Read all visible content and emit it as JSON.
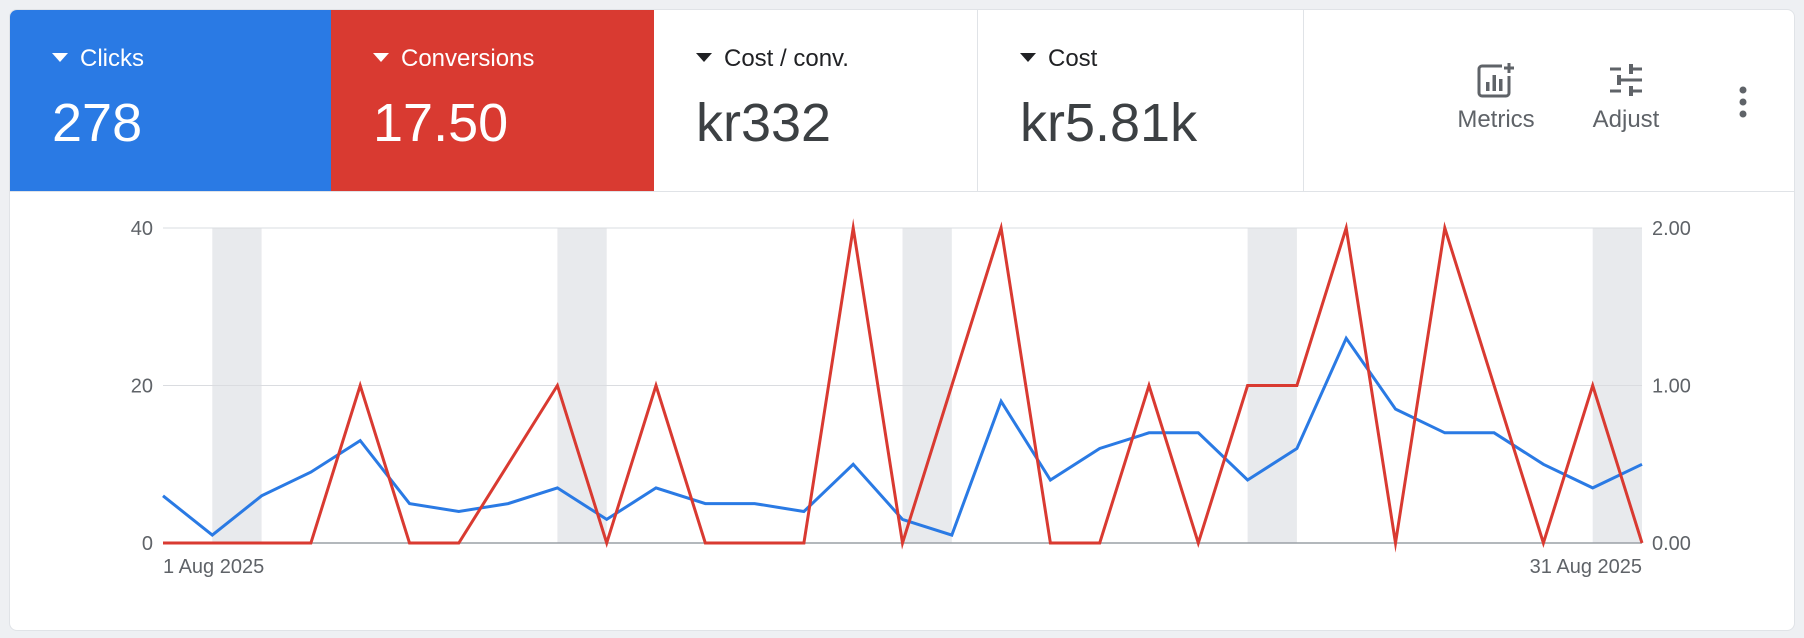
{
  "scorecards": [
    {
      "label": "Clicks",
      "value": "278"
    },
    {
      "label": "Conversions",
      "value": "17.50"
    },
    {
      "label": "Cost / conv.",
      "value": "kr332"
    },
    {
      "label": "Cost",
      "value": "kr5.81k"
    }
  ],
  "toolbar": {
    "metrics_label": "Metrics",
    "adjust_label": "Adjust"
  },
  "colors": {
    "clicks": "#2a7ae4",
    "conversions": "#d93a31",
    "weekend_band": "#e8eaed",
    "grid": "#dadce0"
  },
  "chart_data": {
    "type": "line",
    "x": [
      "2025-08-01",
      "2025-08-02",
      "2025-08-03",
      "2025-08-04",
      "2025-08-05",
      "2025-08-06",
      "2025-08-07",
      "2025-08-08",
      "2025-08-09",
      "2025-08-10",
      "2025-08-11",
      "2025-08-12",
      "2025-08-13",
      "2025-08-14",
      "2025-08-15",
      "2025-08-16",
      "2025-08-17",
      "2025-08-18",
      "2025-08-19",
      "2025-08-20",
      "2025-08-21",
      "2025-08-22",
      "2025-08-23",
      "2025-08-24",
      "2025-08-25",
      "2025-08-26",
      "2025-08-27",
      "2025-08-28",
      "2025-08-29",
      "2025-08-30",
      "2025-08-31"
    ],
    "x_tick_labels": [
      "1 Aug 2025",
      "31 Aug 2025"
    ],
    "y_left": {
      "ticks": [
        "0",
        "20",
        "40"
      ],
      "range": [
        0,
        40
      ]
    },
    "y_right": {
      "ticks": [
        "0.00",
        "1.00",
        "2.00"
      ],
      "range": [
        0,
        2
      ]
    },
    "weekend_bands": [
      [
        "2025-08-02",
        "2025-08-03"
      ],
      [
        "2025-08-09",
        "2025-08-10"
      ],
      [
        "2025-08-16",
        "2025-08-17"
      ],
      [
        "2025-08-23",
        "2025-08-24"
      ],
      [
        "2025-08-30",
        "2025-08-31"
      ]
    ],
    "grid": true,
    "series": [
      {
        "name": "Clicks",
        "axis": "left",
        "values": [
          6,
          1,
          6,
          9,
          13,
          5,
          4,
          5,
          7,
          3,
          7,
          5,
          5,
          4,
          10,
          3,
          1,
          18,
          8,
          12,
          14,
          14,
          8,
          12,
          26,
          17,
          14,
          14,
          10,
          7,
          10
        ]
      },
      {
        "name": "Conversions",
        "axis": "right",
        "values": [
          0,
          0,
          0,
          0,
          1,
          0,
          0,
          0.5,
          1,
          0,
          1,
          0,
          0,
          0,
          2,
          0,
          1,
          2,
          0,
          0,
          1,
          0,
          1,
          1,
          2,
          0,
          2,
          1,
          0,
          1,
          0
        ]
      }
    ]
  }
}
